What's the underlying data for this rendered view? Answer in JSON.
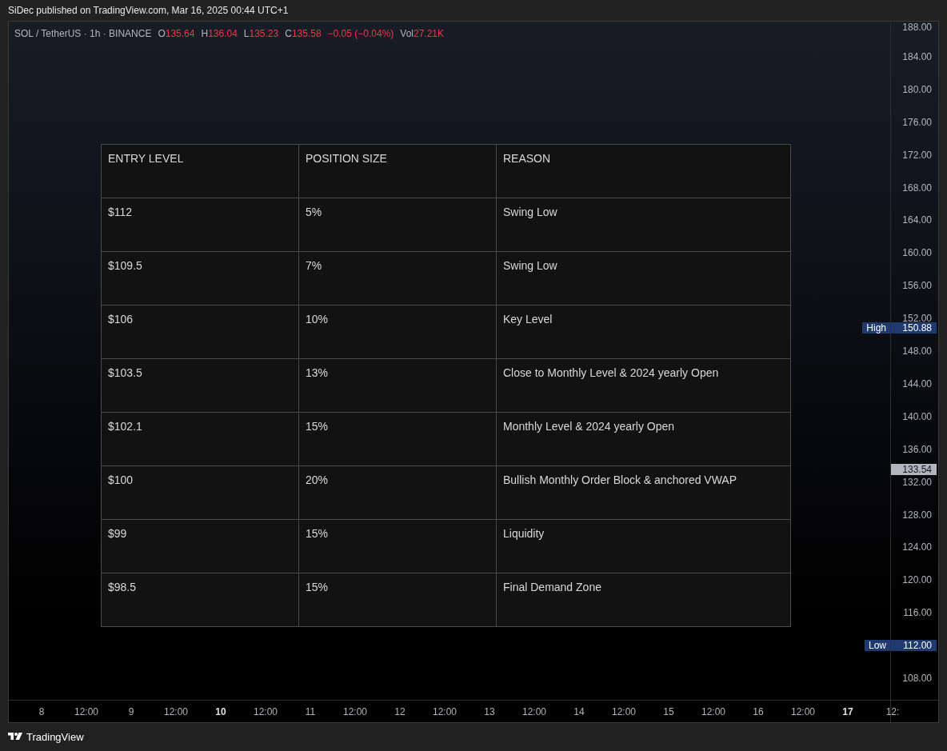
{
  "publish_line": "SiDec published on TradingView.com, Mar 16, 2025 00:44 UTC+1",
  "legend": {
    "symbol": "SOL / TetherUS · 1h · BINANCE",
    "values": [
      {
        "label": "O",
        "value": "135.64"
      },
      {
        "label": "H",
        "value": "136.04"
      },
      {
        "label": "L",
        "value": "135.23"
      },
      {
        "label": "C",
        "value": "135.58"
      },
      {
        "value": "−0.05 (−0.04%)"
      },
      {
        "label": "Vol",
        "value": "27.21K"
      }
    ]
  },
  "table": {
    "columns": [
      "ENTRY LEVEL",
      "POSITION SIZE",
      "REASON"
    ],
    "rows": [
      [
        "$112",
        "5%",
        "Swing Low"
      ],
      [
        "$109.5",
        "7%",
        "Swing Low"
      ],
      [
        "$106",
        "10%",
        "Key Level"
      ],
      [
        "$103.5",
        "13%",
        "Close to Monthly Level & 2024 yearly Open"
      ],
      [
        "$102.1",
        "15%",
        "Monthly Level & 2024 yearly Open"
      ],
      [
        "$100",
        "20%",
        "Bullish Monthly Order Block & anchored VWAP"
      ],
      [
        "$99",
        "15%",
        "Liquidity"
      ],
      [
        "$98.5",
        "15%",
        "Final Demand Zone"
      ]
    ]
  },
  "price_axis": [
    "188.00",
    "184.00",
    "180.00",
    "176.00",
    "172.00",
    "168.00",
    "164.00",
    "160.00",
    "156.00",
    "152.00",
    "148.00",
    "144.00",
    "140.00",
    "136.00",
    "132.00",
    "128.00",
    "124.00",
    "120.00",
    "116.00",
    "108.00"
  ],
  "price_markers": [
    {
      "kind": "label",
      "label": "High",
      "value": "150.88"
    },
    {
      "kind": "current",
      "value": "133.54"
    },
    {
      "kind": "label",
      "label": "Low",
      "value": "112.00"
    }
  ],
  "time_axis": [
    {
      "label": "8",
      "major": false
    },
    {
      "label": "12:00",
      "major": false
    },
    {
      "label": "9",
      "major": false
    },
    {
      "label": "12:00",
      "major": false
    },
    {
      "label": "10",
      "major": true
    },
    {
      "label": "12:00",
      "major": false
    },
    {
      "label": "11",
      "major": false
    },
    {
      "label": "12:00",
      "major": false
    },
    {
      "label": "12",
      "major": false
    },
    {
      "label": "12:00",
      "major": false
    },
    {
      "label": "13",
      "major": false
    },
    {
      "label": "12:00",
      "major": false
    },
    {
      "label": "14",
      "major": false
    },
    {
      "label": "12:00",
      "major": false
    },
    {
      "label": "15",
      "major": false
    },
    {
      "label": "12:00",
      "major": false
    },
    {
      "label": "16",
      "major": false
    },
    {
      "label": "12:00",
      "major": false
    },
    {
      "label": "17",
      "major": true
    },
    {
      "label": "12:",
      "major": false
    }
  ],
  "footer": {
    "brand": "TradingView"
  }
}
